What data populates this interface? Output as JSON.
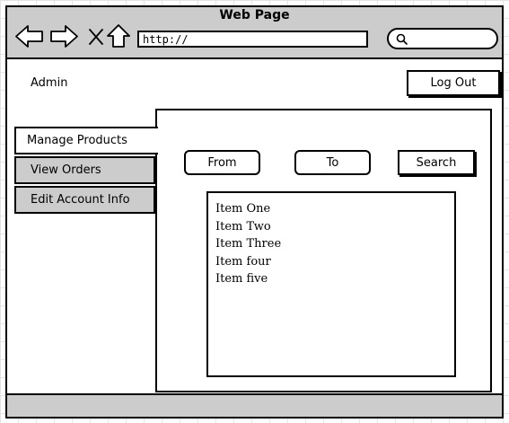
{
  "window": {
    "title": "Web Page"
  },
  "browser": {
    "url": "http://",
    "icons": [
      "back-arrow-icon",
      "forward-arrow-icon",
      "close-x-icon",
      "home-icon",
      "search-icon"
    ]
  },
  "header": {
    "user_label": "Admin",
    "logout_label": "Log Out"
  },
  "sidebar": {
    "tabs": [
      {
        "label": "Manage Products",
        "active": true
      },
      {
        "label": "View Orders",
        "active": false
      },
      {
        "label": "Edit Account Info",
        "active": false
      }
    ]
  },
  "filters": {
    "from_placeholder": "From",
    "to_placeholder": "To",
    "search_label": "Search"
  },
  "results": {
    "items": [
      "Item One",
      "Item Two",
      "Item Three",
      "Item four",
      "Item five"
    ]
  },
  "colors": {
    "chrome_gray": "#cccccc",
    "outline": "#000000",
    "background": "#ffffff"
  }
}
